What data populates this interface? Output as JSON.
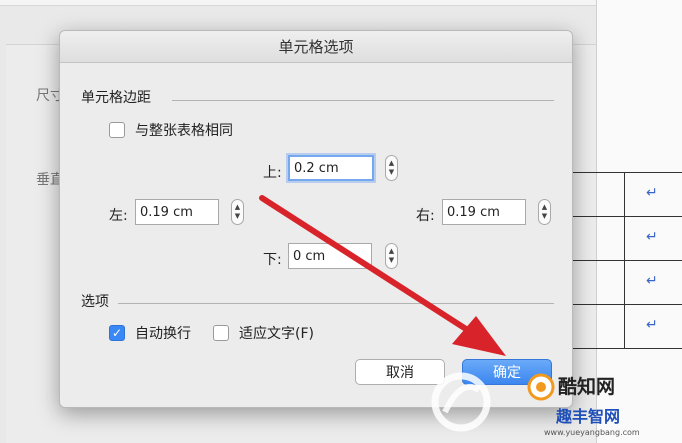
{
  "background": {
    "label_size": "尺寸",
    "label_vertical": "垂直",
    "return_mark": "↵"
  },
  "dialog": {
    "title": "单元格选项",
    "margins": {
      "group_title": "单元格边距",
      "same_as_table": {
        "label": "与整张表格相同",
        "checked": false
      },
      "top": {
        "label": "上:",
        "value": "0.2 cm"
      },
      "left": {
        "label": "左:",
        "value": "0.19 cm"
      },
      "right": {
        "label": "右:",
        "value": "0.19 cm"
      },
      "bottom": {
        "label": "下:",
        "value": "0 cm"
      }
    },
    "options": {
      "group_title": "选项",
      "wrap_text": {
        "label": "自动换行",
        "checked": true
      },
      "fit_text": {
        "label": "适应文字(F)",
        "checked": false
      }
    },
    "buttons": {
      "cancel": "取消",
      "ok": "确定"
    }
  },
  "watermark": {
    "line1": "酷知网",
    "line2": "趣丰智网",
    "url": "www.yueyangbang.com"
  },
  "colors": {
    "accent": "#3a88f5",
    "arrow": "#d9232a"
  }
}
